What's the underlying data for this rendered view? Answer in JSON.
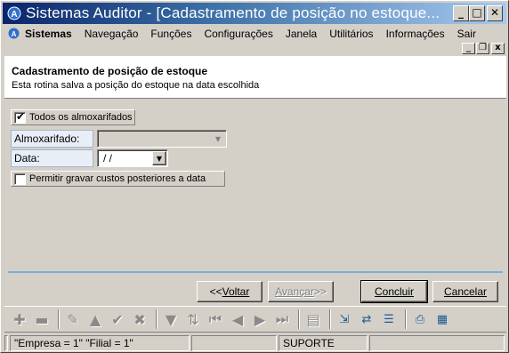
{
  "window": {
    "title": "Sistemas Auditor - [Cadastramento de posição no estoque...",
    "minimize": "_",
    "maximize": "□",
    "close": "✕"
  },
  "menu": {
    "items": [
      "Sistemas",
      "Navegação",
      "Funções",
      "Configurações",
      "Janela",
      "Utilitários",
      "Informações",
      "Sair"
    ]
  },
  "mdi": {
    "minimize": "_",
    "restore": "❐",
    "close": "x"
  },
  "header": {
    "title": "Cadastramento de posição de estoque",
    "subtitle": "Esta rotina salva a posição do estoque na data escolhida"
  },
  "form": {
    "todos_label": "Todos os almoxarifados",
    "todos_checked": true,
    "almox_label": "Almoxarifado:",
    "almox_value": "",
    "data_label": "Data:",
    "data_value": "/ /",
    "permitir_label": "Permitir gravar custos posteriores a data",
    "permitir_checked": false
  },
  "buttons": {
    "voltar_prefix": "<< ",
    "voltar": "Voltar",
    "avancar": "Avançar",
    "avancar_suffix": " >>",
    "concluir": "Concluir",
    "cancelar": "Cancelar"
  },
  "status": {
    "empresa": "\"Empresa = 1\"  \"Filial = 1\"",
    "user": "SUPORTE"
  },
  "colors": {
    "title_start": "#0a246a",
    "title_end": "#a6caf0",
    "separator": "#7aaed8",
    "face": "#d4d0c8"
  }
}
